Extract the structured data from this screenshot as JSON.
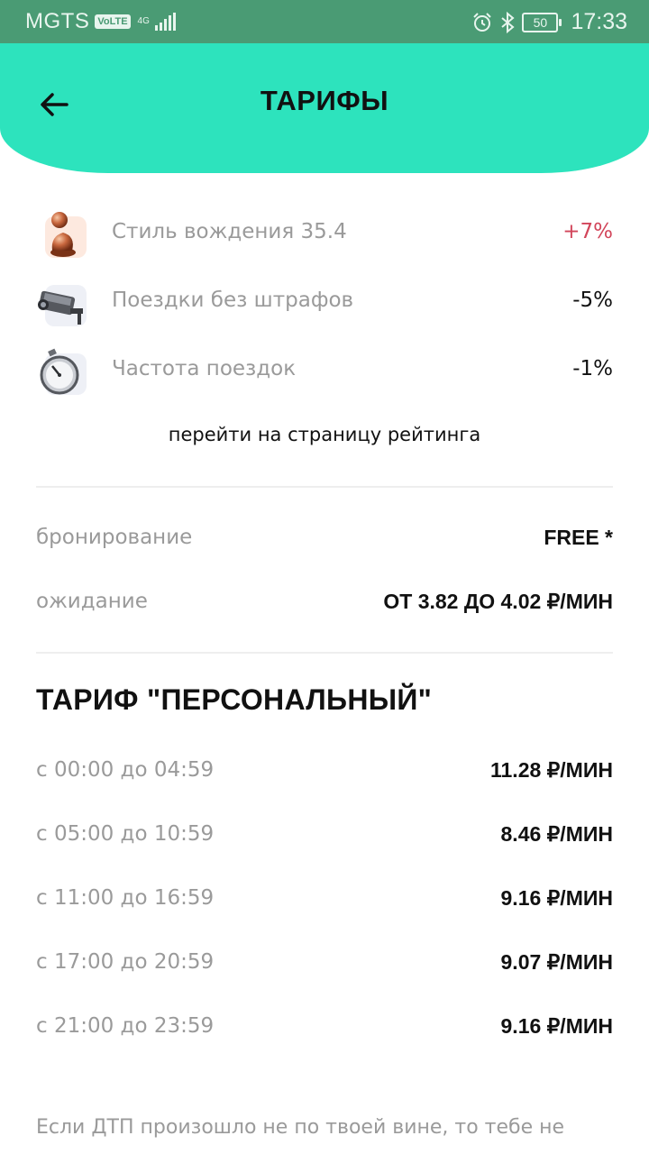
{
  "status_bar": {
    "carrier": "MGTS",
    "volte": "VoLTE",
    "network": "4G",
    "battery": "50",
    "time": "17:33"
  },
  "header": {
    "title": "ТАРИФЫ"
  },
  "rating": {
    "items": [
      {
        "icon": "pawn-icon",
        "label": "Стиль вождения 35.4",
        "value": "+7%",
        "value_color": "#d2455a"
      },
      {
        "icon": "camera-icon",
        "label": "Поездки без штрафов",
        "value": "-5%"
      },
      {
        "icon": "stopwatch-icon",
        "label": "Частота поездок",
        "value": "-1%"
      }
    ],
    "link": "перейти на страницу рейтинга"
  },
  "booking": {
    "booking_label": "бронирование",
    "booking_value": "FREE *",
    "waiting_label": "ожидание",
    "waiting_value": "ОТ 3.82 ДО 4.02 ₽/МИН"
  },
  "tariff": {
    "title": "ТАРИФ \"ПЕРСОНАЛЬНЫЙ\"",
    "rows": [
      {
        "period": "с 00:00 до 04:59",
        "price": "11.28 ₽/МИН"
      },
      {
        "period": "с 05:00 до 10:59",
        "price": "8.46 ₽/МИН"
      },
      {
        "period": "с 11:00 до 16:59",
        "price": "9.16 ₽/МИН"
      },
      {
        "period": "с 17:00 до 20:59",
        "price": "9.07 ₽/МИН"
      },
      {
        "period": "с 21:00 до 23:59",
        "price": "9.16 ₽/МИН"
      }
    ]
  },
  "footnote": "Если ДТП произошло не по твоей вине, то тебе не",
  "colors": {
    "header": "#2de3bd",
    "status_bar": "#4a9b74",
    "positive_value": "#d2455a",
    "muted_text": "#9a9a9a"
  }
}
